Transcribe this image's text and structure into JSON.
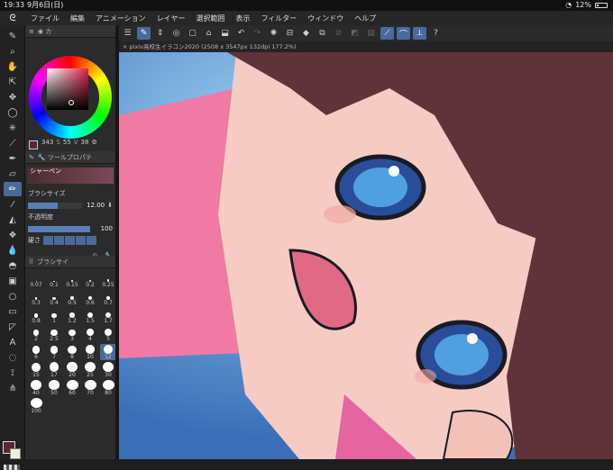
{
  "status": {
    "time": "19:33",
    "date": "9月6日(日)",
    "battery": "12%"
  },
  "menu": {
    "items": [
      "ファイル",
      "編集",
      "アニメーション",
      "レイヤー",
      "選択範囲",
      "表示",
      "フィルター",
      "ウィンドウ",
      "ヘルプ"
    ]
  },
  "color_panel": {
    "h": "343",
    "s": "55",
    "v": "38",
    "s_label": "S",
    "v_label": "V"
  },
  "tool_property": {
    "brush_name": "シャーペン",
    "size_label": "ブラシサイズ",
    "size_value": "12.00",
    "opacity_label": "不透明度",
    "opacity_value": "100",
    "hardness_label": "硬さ",
    "size_fill_pct": 55,
    "opacity_fill_pct": 100
  },
  "brush_size_panel": {
    "title": "ブラシサイ",
    "sizes": [
      "0.07",
      "0.1",
      "0.15",
      "0.2",
      "0.25",
      "0.3",
      "0.4",
      "0.5",
      "0.6",
      "0.7",
      "0.8",
      "1",
      "1.2",
      "1.5",
      "1.7",
      "2",
      "2.5",
      "3",
      "4",
      "5",
      "6",
      "7",
      "8",
      "10",
      "12",
      "15",
      "17",
      "20",
      "25",
      "30",
      "40",
      "50",
      "60",
      "70",
      "80",
      "100"
    ],
    "selected": "12"
  },
  "canvas": {
    "tab_title": "pixiv高校生イラコン2020 (2508 x 3547px 132dpi 177.2%)"
  },
  "colors": {
    "accent": "#4a6a9a",
    "main_color": "#5a2632",
    "sub_color": "#f5ecd8"
  }
}
